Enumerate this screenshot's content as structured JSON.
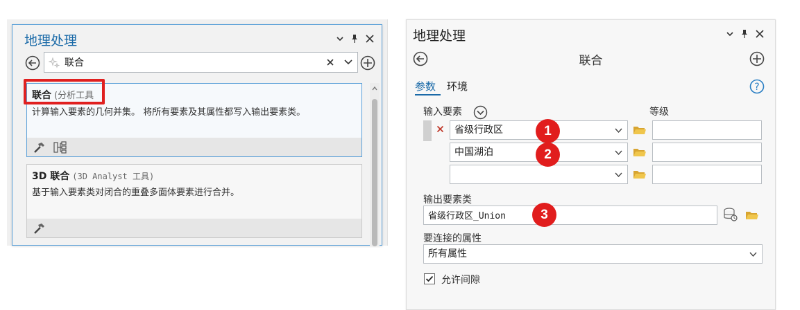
{
  "left_panel": {
    "title": "地理处理",
    "search": {
      "value": "联合"
    },
    "results": [
      {
        "name": "联合",
        "category": "(分析工具",
        "description": "计算输入要素的几何并集。 将所有要素及其属性都写入输出要素类。"
      },
      {
        "name": "3D 联合",
        "category": "(3D Analyst 工具)",
        "description": "基于输入要素类对闭合的重叠多面体要素进行合并。"
      }
    ]
  },
  "right_panel": {
    "title": "地理处理",
    "tool_name": "联合",
    "tabs": [
      {
        "label": "参数"
      },
      {
        "label": "环境"
      }
    ],
    "input_features": {
      "label": "输入要素",
      "rank_label": "等级",
      "rows": [
        {
          "value": "省级行政区",
          "rank": ""
        },
        {
          "value": "中国湖泊",
          "rank": ""
        },
        {
          "value": "",
          "rank": ""
        }
      ]
    },
    "output": {
      "label": "输出要素类",
      "value": "省级行政区_Union"
    },
    "join_attributes": {
      "label": "要连接的属性",
      "value": "所有属性"
    },
    "gaps": {
      "label": "允许间隙",
      "checked": true
    }
  },
  "annotations": {
    "badges": [
      "1",
      "2",
      "3"
    ],
    "color": "#e11d1d"
  },
  "colors": {
    "accent": "#1a6aa8",
    "highlight": "#e02020",
    "folder": "#e0b33e"
  }
}
